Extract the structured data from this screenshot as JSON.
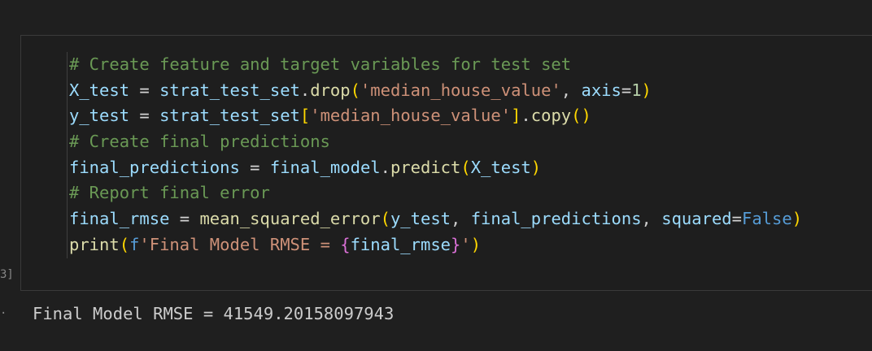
{
  "cell": {
    "execution_count": "3]",
    "lines": [
      [
        {
          "t": "# Create feature and target variables for test set",
          "c": "comment"
        }
      ],
      [
        {
          "t": "X_test",
          "c": "var"
        },
        {
          "t": " = ",
          "c": "op"
        },
        {
          "t": "strat_test_set",
          "c": "var"
        },
        {
          "t": ".",
          "c": "punc"
        },
        {
          "t": "drop",
          "c": "func"
        },
        {
          "t": "(",
          "c": "b1"
        },
        {
          "t": "'median_house_value'",
          "c": "str"
        },
        {
          "t": ", ",
          "c": "punc"
        },
        {
          "t": "axis",
          "c": "var"
        },
        {
          "t": "=",
          "c": "op"
        },
        {
          "t": "1",
          "c": "num"
        },
        {
          "t": ")",
          "c": "b1"
        }
      ],
      [
        {
          "t": "y_test",
          "c": "var"
        },
        {
          "t": " = ",
          "c": "op"
        },
        {
          "t": "strat_test_set",
          "c": "var"
        },
        {
          "t": "[",
          "c": "b1"
        },
        {
          "t": "'median_house_value'",
          "c": "str"
        },
        {
          "t": "]",
          "c": "b1"
        },
        {
          "t": ".",
          "c": "punc"
        },
        {
          "t": "copy",
          "c": "func"
        },
        {
          "t": "()",
          "c": "b1"
        }
      ],
      [
        {
          "t": "# Create final predictions",
          "c": "comment"
        }
      ],
      [
        {
          "t": "final_predictions",
          "c": "var"
        },
        {
          "t": " = ",
          "c": "op"
        },
        {
          "t": "final_model",
          "c": "var"
        },
        {
          "t": ".",
          "c": "punc"
        },
        {
          "t": "predict",
          "c": "func"
        },
        {
          "t": "(",
          "c": "b1"
        },
        {
          "t": "X_test",
          "c": "var"
        },
        {
          "t": ")",
          "c": "b1"
        }
      ],
      [
        {
          "t": "# Report final error",
          "c": "comment"
        }
      ],
      [
        {
          "t": "final_rmse",
          "c": "var"
        },
        {
          "t": " = ",
          "c": "op"
        },
        {
          "t": "mean_squared_error",
          "c": "func"
        },
        {
          "t": "(",
          "c": "b1"
        },
        {
          "t": "y_test",
          "c": "var"
        },
        {
          "t": ", ",
          "c": "punc"
        },
        {
          "t": "final_predictions",
          "c": "var"
        },
        {
          "t": ", ",
          "c": "punc"
        },
        {
          "t": "squared",
          "c": "var"
        },
        {
          "t": "=",
          "c": "op"
        },
        {
          "t": "False",
          "c": "kw"
        },
        {
          "t": ")",
          "c": "b1"
        }
      ],
      [
        {
          "t": "print",
          "c": "func"
        },
        {
          "t": "(",
          "c": "b1"
        },
        {
          "t": "f",
          "c": "kw"
        },
        {
          "t": "'Final Model RMSE = ",
          "c": "str"
        },
        {
          "t": "{",
          "c": "b2"
        },
        {
          "t": "final_rmse",
          "c": "var"
        },
        {
          "t": "}",
          "c": "b2"
        },
        {
          "t": "'",
          "c": "str"
        },
        {
          "t": ")",
          "c": "b1"
        }
      ]
    ]
  },
  "output": {
    "marker": "·",
    "text": "Final Model RMSE = 41549.20158097943"
  },
  "colors": {
    "comment": "#6a9955",
    "variable": "#9cdcfe",
    "function": "#dcdcaa",
    "string": "#ce9178",
    "number": "#b5cea8",
    "keyword": "#569cd6",
    "bracket_level1": "#ffd700",
    "bracket_level2": "#da70d6"
  }
}
